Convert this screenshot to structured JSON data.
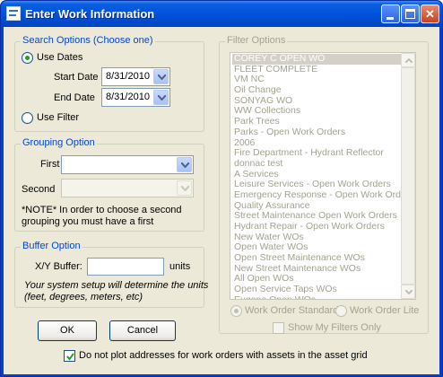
{
  "window": {
    "title": "Enter Work Information"
  },
  "search_options": {
    "group_label": "Search Options (Choose one)",
    "use_dates_label": "Use Dates",
    "use_dates_checked": true,
    "start_date_label": "Start Date",
    "start_date_value": "8/31/2010",
    "end_date_label": "End Date",
    "end_date_value": "8/31/2010",
    "use_filter_label": "Use Filter",
    "use_filter_checked": false
  },
  "grouping_option": {
    "group_label": "Grouping Option",
    "first_label": "First",
    "first_value": "",
    "second_label": "Second",
    "second_value": "",
    "note_line1": "*NOTE* In order to choose a second",
    "note_line2": "grouping you must have a first"
  },
  "buffer_option": {
    "group_label": "Buffer Option",
    "buffer_label": "X/Y Buffer:",
    "buffer_value": "",
    "units_label": "units",
    "info_line1": "Your system setup will determine the units",
    "info_line2": "(feet, degrees, meters, etc)"
  },
  "buttons": {
    "ok": "OK",
    "cancel": "Cancel"
  },
  "footer": {
    "no_plot_label": "Do not plot addresses for work orders with assets in the asset grid",
    "no_plot_checked": true
  },
  "filter_options": {
    "group_label": "Filter Options",
    "items": [
      "COREY C OPEN WO",
      "FLEET COMPLETE",
      "VM NC",
      "Oil Change",
      "SONYAG WO",
      "WW Collections",
      "Park Trees",
      "Parks - Open Work Orders",
      "2006",
      "Fire Department - Hydrant Reflector",
      "donnac test",
      "A Services",
      "Leisure Services - Open Work Orders",
      "Emergency Response - Open Work Orders",
      "Quality Assurance",
      "Street Maintenance Open Work Orders",
      "Hydrant Repair - Open Work Orders",
      "New Water WOs",
      "Open Water WOs",
      "Open Street Maintenance WOs",
      "New Street Maintenance WOs",
      "All Open WOs",
      "Open Service Taps WOs",
      "Eugene Open WOs"
    ],
    "selected_index": 0,
    "work_order_standard_label": "Work Order Standard",
    "work_order_standard_checked": true,
    "work_order_lite_label": "Work Order Lite",
    "work_order_lite_checked": false,
    "show_my_filters_label": "Show My Filters Only",
    "show_my_filters_checked": false
  }
}
